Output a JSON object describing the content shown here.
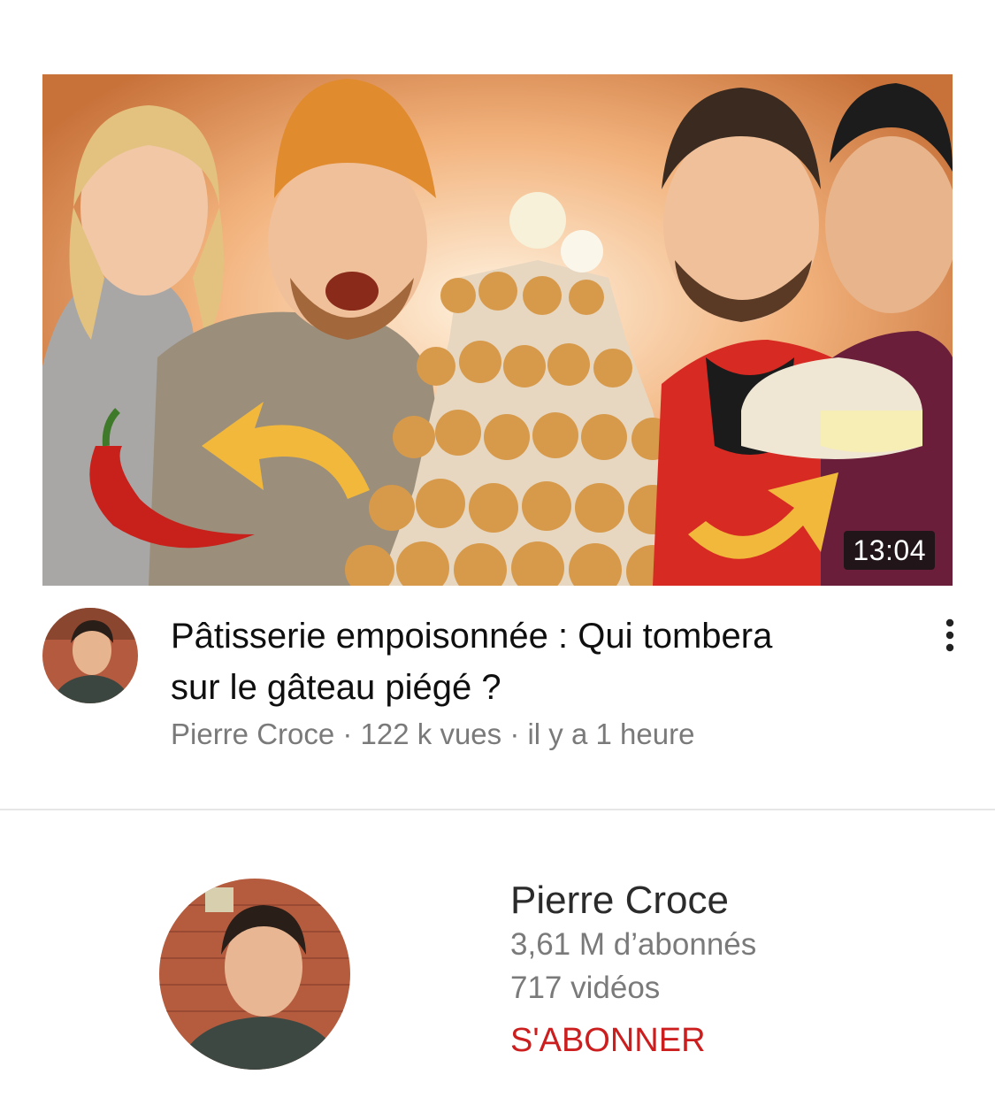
{
  "video": {
    "duration": "13:04",
    "title_line1": "Pâtisserie empoisonnée : Qui tombera",
    "title_line2": "sur le gâteau piégé ?",
    "meta": "Pierre Croce · 122 k vues · il y a 1 heure"
  },
  "channel": {
    "name": "Pierre Croce",
    "subscribers": "3,61 M d’abonnés",
    "videos": "717 vidéos",
    "subscribe_label": "S'ABONNER"
  },
  "icons": {
    "more": "more-vert-icon"
  },
  "colors": {
    "subscribe": "#cc1e1e",
    "meta_text": "#7a7a7a",
    "title_text": "#0f0f0f",
    "duration_bg": "#141414"
  }
}
